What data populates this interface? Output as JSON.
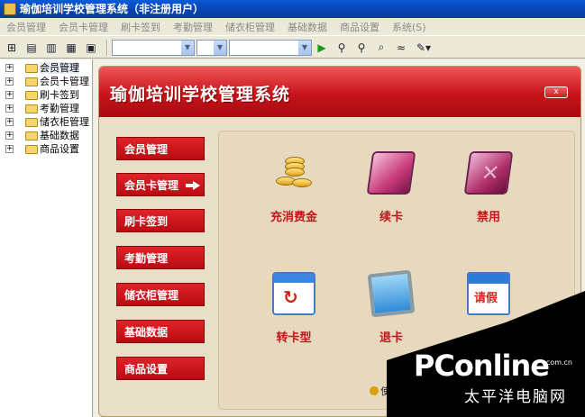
{
  "window": {
    "title": "瑜伽培训学校管理系统（非注册用户）"
  },
  "menu": [
    "会员管理",
    "会员卡管理",
    "刷卡签到",
    "考勤管理",
    "储衣柜管理",
    "基础数据",
    "商品设置",
    "系统(S)"
  ],
  "tree": [
    {
      "label": "会员管理"
    },
    {
      "label": "会员卡管理"
    },
    {
      "label": "刷卡签到"
    },
    {
      "label": "考勤管理"
    },
    {
      "label": "储衣柜管理"
    },
    {
      "label": "基础数据"
    },
    {
      "label": "商品设置"
    }
  ],
  "banner": {
    "title": "瑜伽培训学校管理系统",
    "close_label": "x"
  },
  "nav": [
    {
      "label": "会员管理"
    },
    {
      "label": "会员卡管理"
    },
    {
      "label": "刷卡签到"
    },
    {
      "label": "考勤管理"
    },
    {
      "label": "储衣柜管理"
    },
    {
      "label": "基础数据"
    },
    {
      "label": "商品设置"
    }
  ],
  "tiles": [
    {
      "label": "充消费金",
      "icon": "coins-icon"
    },
    {
      "label": "续卡",
      "icon": "folder-renew-icon"
    },
    {
      "label": "禁用",
      "icon": "folder-disable-icon"
    },
    {
      "label": "转卡型",
      "icon": "calendar-transfer-icon"
    },
    {
      "label": "退卡",
      "icon": "card-return-icon"
    },
    {
      "label": "",
      "icon": "leave-calendar-icon",
      "glyph": "请假"
    }
  ],
  "hint": {
    "text": "使用F"
  },
  "watermark": {
    "brand": "PConline",
    "domain": ".com.cn",
    "cn": "太平洋电脑网"
  },
  "colors": {
    "accent": "#c8141c",
    "title_blue": "#0842b0"
  }
}
